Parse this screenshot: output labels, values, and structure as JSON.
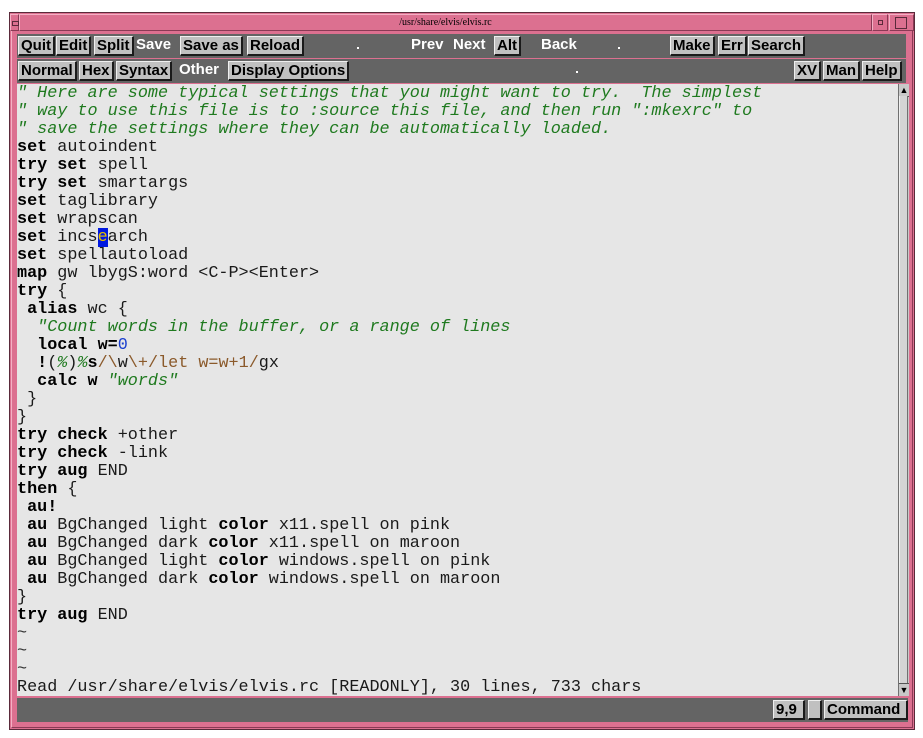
{
  "window": {
    "title": "/usr/share/elvis/elvis.rc"
  },
  "toolbar1": {
    "buttons": [
      {
        "label": "Quit",
        "style": "raised"
      },
      {
        "label": "Edit",
        "style": "raised"
      },
      {
        "label": "Split",
        "style": "raised"
      },
      {
        "label": "Save",
        "style": "flat"
      },
      {
        "label": "Save as",
        "style": "raised"
      },
      {
        "label": "Reload",
        "style": "raised"
      },
      {
        "label": "Prev",
        "style": "flat"
      },
      {
        "label": "Next",
        "style": "flat"
      },
      {
        "label": "Alt",
        "style": "raised"
      },
      {
        "label": "Back",
        "style": "flat"
      },
      {
        "label": "Make",
        "style": "raised"
      },
      {
        "label": "Err",
        "style": "raised"
      },
      {
        "label": "Search",
        "style": "raised"
      }
    ]
  },
  "toolbar2": {
    "buttons": [
      {
        "label": "Normal",
        "style": "raised"
      },
      {
        "label": "Hex",
        "style": "raised"
      },
      {
        "label": "Syntax",
        "style": "raised"
      },
      {
        "label": "Other",
        "style": "flat"
      },
      {
        "label": "Display Options",
        "style": "raised"
      },
      {
        "label": "XV",
        "style": "raised"
      },
      {
        "label": "Man",
        "style": "raised"
      },
      {
        "label": "Help",
        "style": "raised"
      }
    ]
  },
  "editor": {
    "lines": [
      [
        {
          "t": "\" Here are some typical settings that you might want to try.  The simplest",
          "s": "c"
        }
      ],
      [
        {
          "t": "\" way to use this file is to :source this file, and then run \":mkexrc\" to",
          "s": "c"
        }
      ],
      [
        {
          "t": "\" save the settings where they can be automatically loaded.",
          "s": "c"
        }
      ],
      [
        {
          "t": "set",
          "s": "k"
        },
        {
          "t": " autoindent",
          "s": ""
        }
      ],
      [
        {
          "t": "try set",
          "s": "k"
        },
        {
          "t": " spell",
          "s": ""
        }
      ],
      [
        {
          "t": "try set",
          "s": "k"
        },
        {
          "t": " smartargs",
          "s": ""
        }
      ],
      [
        {
          "t": "set",
          "s": "k"
        },
        {
          "t": " taglibrary",
          "s": ""
        }
      ],
      [
        {
          "t": "set",
          "s": "k"
        },
        {
          "t": " wrapscan",
          "s": ""
        }
      ],
      [
        {
          "t": "set",
          "s": "k"
        },
        {
          "t": " incs",
          "s": ""
        },
        {
          "t": "e",
          "s": "cursor"
        },
        {
          "t": "arch",
          "s": ""
        }
      ],
      [
        {
          "t": "set",
          "s": "k"
        },
        {
          "t": " spellautoload",
          "s": ""
        }
      ],
      [
        {
          "t": "map",
          "s": "k"
        },
        {
          "t": " gw lbygS:word <C-P><Enter>",
          "s": ""
        }
      ],
      [
        {
          "t": "try",
          "s": "k"
        },
        {
          "t": " {",
          "s": ""
        }
      ],
      [
        {
          "t": " alias",
          "s": "k"
        },
        {
          "t": " wc {",
          "s": ""
        }
      ],
      [
        {
          "t": "  \"Count words in the buffer, or a range of lines",
          "s": "c"
        }
      ],
      [
        {
          "t": "  local w=",
          "s": "k"
        },
        {
          "t": "0",
          "s": "n"
        }
      ],
      [
        {
          "t": "  !",
          "s": "k"
        },
        {
          "t": "(",
          "s": ""
        },
        {
          "t": "%",
          "s": "c"
        },
        {
          "t": ")",
          "s": ""
        },
        {
          "t": "%",
          "s": "c"
        },
        {
          "t": "s",
          "s": "k"
        },
        {
          "t": "/\\",
          "s": "r"
        },
        {
          "t": "w",
          "s": ""
        },
        {
          "t": "\\+/let w=w+1/",
          "s": "r"
        },
        {
          "t": "gx",
          "s": ""
        }
      ],
      [
        {
          "t": "  calc w ",
          "s": "k"
        },
        {
          "t": "\"words\"",
          "s": "c"
        }
      ],
      [
        {
          "t": " }",
          "s": ""
        }
      ],
      [
        {
          "t": "}",
          "s": ""
        }
      ],
      [
        {
          "t": "try check",
          "s": "k"
        },
        {
          "t": " +other",
          "s": ""
        }
      ],
      [
        {
          "t": "try check",
          "s": "k"
        },
        {
          "t": " -link",
          "s": ""
        }
      ],
      [
        {
          "t": "try aug",
          "s": "k"
        },
        {
          "t": " END",
          "s": ""
        }
      ],
      [
        {
          "t": "then",
          "s": "k"
        },
        {
          "t": " {",
          "s": ""
        }
      ],
      [
        {
          "t": " au!",
          "s": "k"
        }
      ],
      [
        {
          "t": " au",
          "s": "k"
        },
        {
          "t": " BgChanged light ",
          "s": ""
        },
        {
          "t": "color",
          "s": "k"
        },
        {
          "t": " x11.spell on pink",
          "s": ""
        }
      ],
      [
        {
          "t": " au",
          "s": "k"
        },
        {
          "t": " BgChanged dark ",
          "s": ""
        },
        {
          "t": "color",
          "s": "k"
        },
        {
          "t": " x11.spell on maroon",
          "s": ""
        }
      ],
      [
        {
          "t": " au",
          "s": "k"
        },
        {
          "t": " BgChanged light ",
          "s": ""
        },
        {
          "t": "color",
          "s": "k"
        },
        {
          "t": " windows.spell on pink",
          "s": ""
        }
      ],
      [
        {
          "t": " au",
          "s": "k"
        },
        {
          "t": " BgChanged dark ",
          "s": ""
        },
        {
          "t": "color",
          "s": "k"
        },
        {
          "t": " windows.spell on maroon",
          "s": ""
        }
      ],
      [
        {
          "t": "}",
          "s": ""
        }
      ],
      [
        {
          "t": "try aug",
          "s": "k"
        },
        {
          "t": " END",
          "s": ""
        }
      ],
      [
        {
          "t": "~",
          "s": "tilde"
        }
      ],
      [
        {
          "t": "~",
          "s": "tilde"
        }
      ],
      [
        {
          "t": "~",
          "s": "tilde"
        }
      ],
      [
        {
          "t": "Read /usr/share/elvis/elvis.rc [READONLY], 30 lines, 733 chars",
          "s": ""
        }
      ]
    ]
  },
  "scrollbar": {
    "up_icon": "▲",
    "down_icon": "▼"
  },
  "status": {
    "cursor_position": "9,9",
    "mode_indicator": "",
    "mode": "Command"
  },
  "colors": {
    "frame": "#dc7090",
    "toolbar": "#646464",
    "editor_bg": "#e6e6e6",
    "comment": "#1f7a1f",
    "number": "#1a3fcf",
    "regex": "#8b5a2b",
    "cursor_bg": "#0018e0",
    "cursor_fg": "#e8c000"
  }
}
